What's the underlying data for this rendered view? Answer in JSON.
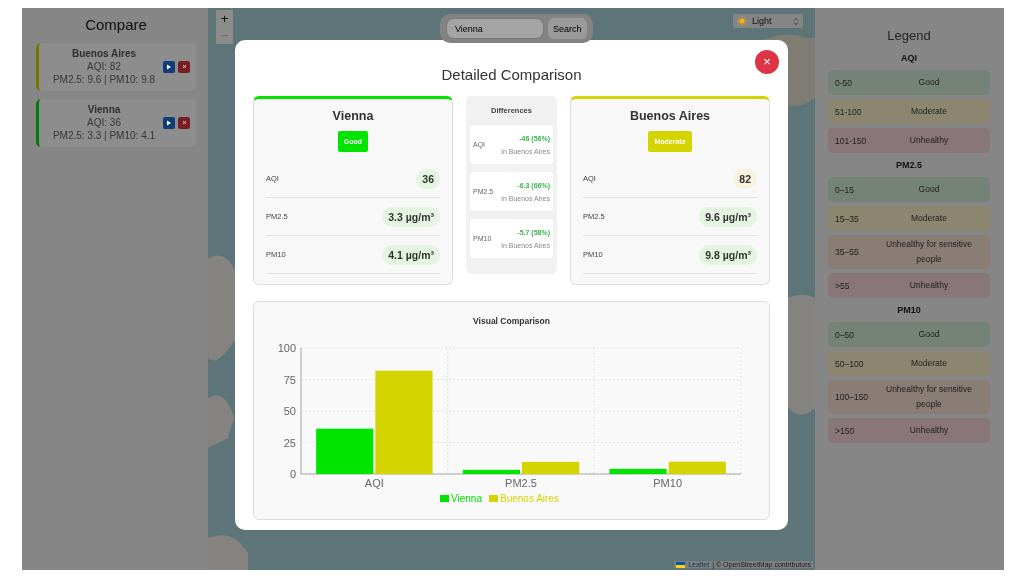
{
  "sidebar": {
    "title": "Compare",
    "cities": [
      {
        "name": "Buenos Aires",
        "aqi": "AQI: 82",
        "particles": "PM2.5: 9.6 | PM10: 9.8",
        "color": "#757500"
      },
      {
        "name": "Vienna",
        "aqi": "AQI: 36",
        "particles": "PM2.5: 3.3 | PM10: 4.1",
        "color": "#007d00"
      }
    ]
  },
  "map": {
    "zoom": [
      {
        "label": "+",
        "disabled": false
      },
      {
        "label": "−",
        "disabled": true
      }
    ],
    "search": {
      "value": "Vienna",
      "button": "Search"
    },
    "theme": {
      "value": "Light"
    },
    "attribution": {
      "link": "Leaflet",
      "text": "| © OpenStreetMap contributors"
    }
  },
  "legend": {
    "title": "Legend",
    "sections": [
      {
        "title": "AQI",
        "rows": [
          {
            "range": "0-50",
            "label": "Good",
            "color": "#758278"
          },
          {
            "range": "51-100",
            "label": "Moderate",
            "color": "#8c8671"
          },
          {
            "range": "101-150",
            "label": "Unhealthy",
            "color": "#887678"
          }
        ]
      },
      {
        "title": "PM2.5",
        "rows": [
          {
            "range": "0–15",
            "label": "Good",
            "color": "#758278"
          },
          {
            "range": "15–35",
            "label": "Moderate",
            "color": "#8c8671"
          },
          {
            "range": "35–55",
            "label": "Unhealthy for sensitive people",
            "color": "#8a7d75"
          },
          {
            "range": ">55",
            "label": "Unhealthy",
            "color": "#887678"
          }
        ]
      },
      {
        "title": "PM10",
        "rows": [
          {
            "range": "0–50",
            "label": "Good",
            "color": "#758278"
          },
          {
            "range": "50–100",
            "label": "Moderate",
            "color": "#8c8671"
          },
          {
            "range": "100–150",
            "label": "Unhealthy for sensitive people",
            "color": "#8a7d75"
          },
          {
            "range": ">150",
            "label": "Unhealthy",
            "color": "#887678"
          }
        ]
      }
    ]
  },
  "modal": {
    "title": "Detailed Comparison",
    "close": "×",
    "cities": [
      {
        "name": "Vienna",
        "badge": "Good",
        "color": "#00e400",
        "metrics": [
          {
            "label": "AQI",
            "value": "36",
            "color": "#e3f4e0"
          },
          {
            "label": "PM2.5",
            "value": "3.3 µg/m³",
            "color": "#e3f4e0"
          },
          {
            "label": "PM10",
            "value": "4.1 µg/m³",
            "color": "#e3f4e0"
          }
        ]
      },
      {
        "name": "Buenos Aires",
        "badge": "Moderate",
        "color": "#d4d400",
        "metrics": [
          {
            "label": "AQI",
            "value": "82",
            "color": "#f7f3df"
          },
          {
            "label": "PM2.5",
            "value": "9.6 µg/m³",
            "color": "#e3f4e0"
          },
          {
            "label": "PM10",
            "value": "9.8 µg/m³",
            "color": "#e3f4e0"
          }
        ]
      }
    ],
    "differences": {
      "title": "Differences",
      "items": [
        {
          "label": "AQI",
          "delta": "-46 (56%)",
          "note": "in Buenos Aires"
        },
        {
          "label": "PM2.5",
          "delta": "-6.3 (66%)",
          "note": "in Buenos Aires"
        },
        {
          "label": "PM10",
          "delta": "-5.7 (58%)",
          "note": "in Buenos Aires"
        }
      ]
    },
    "chart": {
      "title": "Visual Comparison",
      "chart_data": {
        "type": "bar",
        "categories": [
          "AQI",
          "PM2.5",
          "PM10"
        ],
        "series": [
          {
            "name": "Vienna",
            "color": "#00e400",
            "values": [
              36,
              3.3,
              4.1
            ]
          },
          {
            "name": "Buenos Aires",
            "color": "#d4d400",
            "values": [
              82,
              9.6,
              9.8
            ]
          }
        ],
        "ylim": [
          0,
          100
        ],
        "yticks": [
          0,
          25,
          50,
          75,
          100
        ],
        "grid": true,
        "legend": "bottom"
      }
    }
  }
}
